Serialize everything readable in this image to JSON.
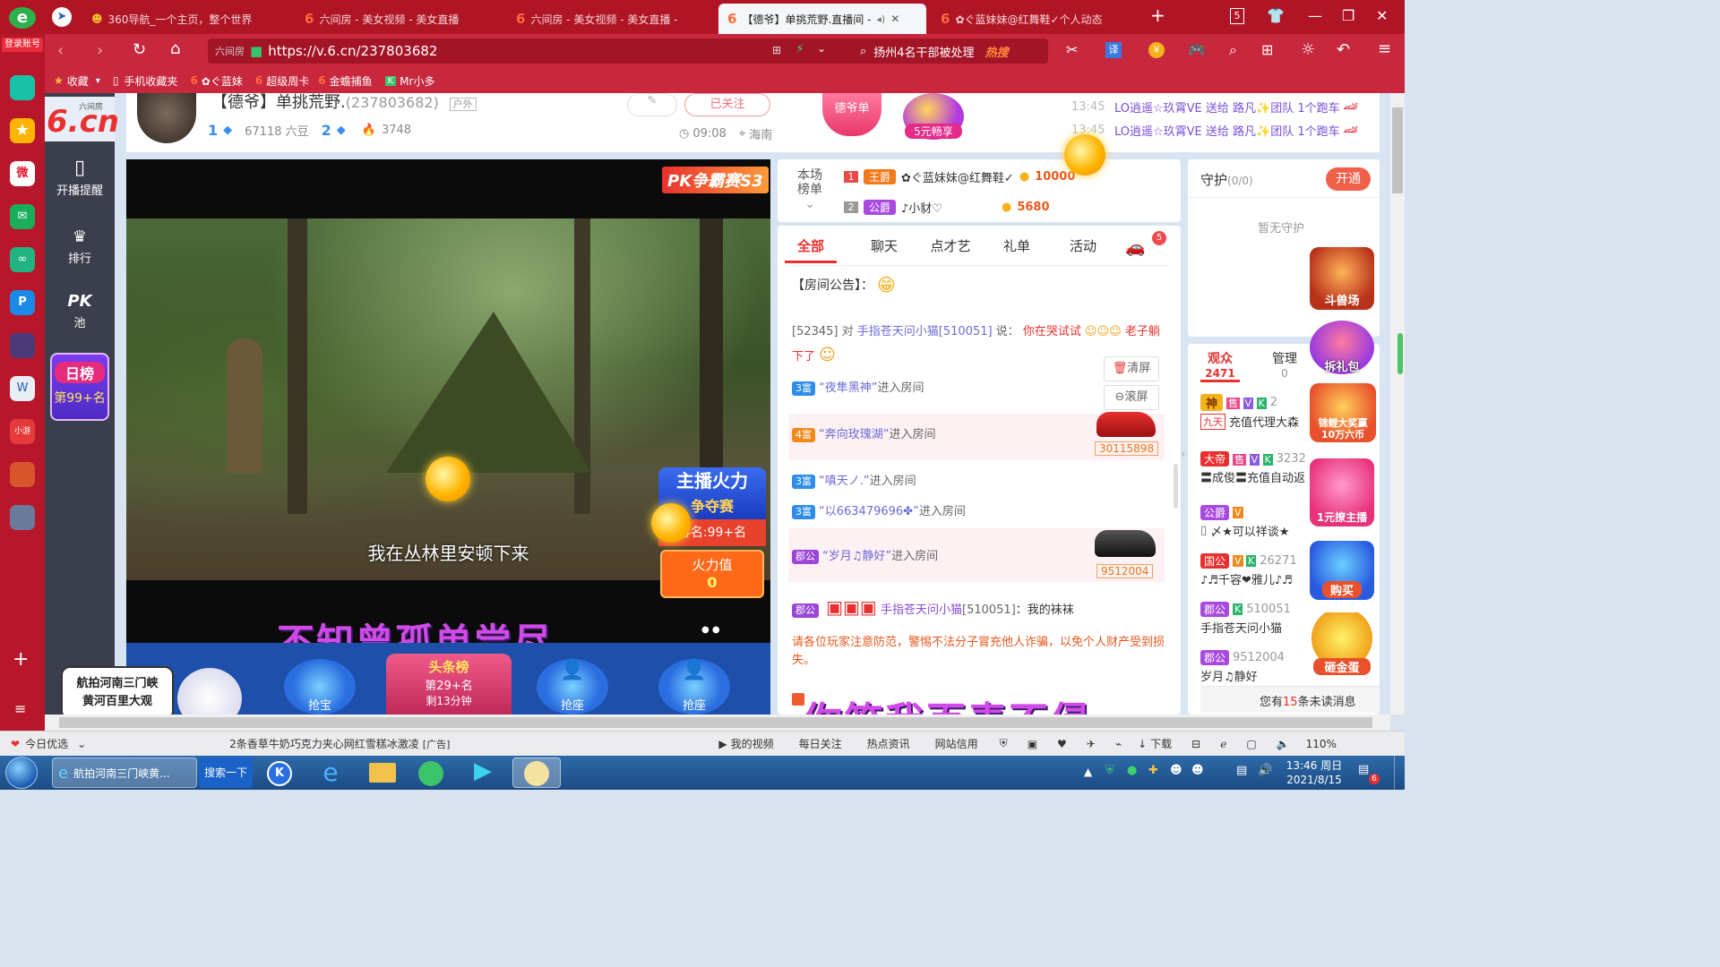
{
  "browser": {
    "tabs": [
      {
        "label": "360导航_一个主页，整个世界",
        "active": false
      },
      {
        "label": "六间房 - 美女视频 - 美女直播",
        "active": false
      },
      {
        "label": "六间房 - 美女视频 - 美女直播 -",
        "active": false
      },
      {
        "label": "【德爷】单挑荒野.直播间 -",
        "active": true
      },
      {
        "label": "✿ぐ蓝妹妹@红舞鞋✓个人动态",
        "active": false
      }
    ],
    "tab_count": "5",
    "url": "https://v.6.cn/237803682",
    "url_prefix": "六间房",
    "search_text": "扬州4名干部被处理",
    "search_hot": "热搜",
    "bookmarks": [
      "收藏",
      "手机收藏夹",
      "✿ぐ蓝妹",
      "超级周卡",
      "金蟾捕鱼",
      "Mr小多"
    ],
    "login_label": "登录账号",
    "zoom": "110%"
  },
  "site": {
    "logo_small": "六间房",
    "logo": "6.cn",
    "nav": [
      {
        "label": "开播提醒",
        "icon": "phone-icon"
      },
      {
        "label": "排行",
        "icon": "crown-icon"
      },
      {
        "label": "PK池",
        "icon": "pk-icon"
      }
    ],
    "rank_title": "日榜",
    "rank_value": "第99+名"
  },
  "room": {
    "title": "【德爷】单挑荒野.",
    "room_id": "(237803682)",
    "tag": "户外",
    "level1": "1",
    "fans_label": "67118 六豆",
    "level2": "2",
    "hot": "3748",
    "follow_label": "已关注",
    "time": "09:08",
    "location": "海南",
    "promo1": "德爷单",
    "promo2": "5元畅享",
    "gift_feed": [
      {
        "time": "13:45",
        "text": "LO逍遥☆玖霄VE 送给 路凡✨团队 1个跑车"
      },
      {
        "time": "13:45",
        "text": "LO逍遥☆玖霄VE 送给 路凡✨团队 1个跑车"
      }
    ]
  },
  "video": {
    "banner": "PK争霸赛S3",
    "subtitle": "我在丛林里安顿下来",
    "lyric1": "不知曾孤单尝尽",
    "lyric2": "你笑我百毒不侵",
    "fire_title1": "主播火力",
    "fire_title2": "争夺赛",
    "fire_rank": "排名:99+名",
    "fire_label": "火力值",
    "fire_value": "0",
    "seats": [
      "抢宝",
      "头条榜",
      "抢座",
      "抢座"
    ],
    "headline_rank": "第29+名",
    "headline_timer": "剩13分钟",
    "ad_text1": "航拍河南三门峡",
    "ad_text2": "黄河百里大观"
  },
  "board": {
    "label1": "本场",
    "label2": "榜单",
    "rows": [
      {
        "rank": "1",
        "title": "王爵",
        "name": "✿ぐ蓝妹妹@红舞鞋✓",
        "score": "10000"
      },
      {
        "rank": "2",
        "title": "公爵",
        "name": "♪小豺♡",
        "score": "5680"
      }
    ]
  },
  "chat": {
    "tabs": [
      "全部",
      "聊天",
      "点才艺",
      "礼单",
      "活动"
    ],
    "car_badge": "5",
    "notice_label": "【房间公告】：",
    "first_msg": {
      "id": "[52345]",
      "verb": "对",
      "target": "手指苍天问小猫[510051]",
      "said": "说：",
      "text": "你在哭试试",
      "tail": "老子躺下了"
    },
    "enter_msgs": [
      {
        "badge": "3富",
        "name": "“夜隼黑神”",
        "suffix": "进入房间"
      },
      {
        "badge": "4富",
        "name": "“奔向玫瑰湖”",
        "suffix": "进入房间"
      },
      {
        "badge": "3富",
        "name": "“嗔天ノ.”",
        "suffix": "进入房间"
      },
      {
        "badge": "3富",
        "name": "“以663479696✤”",
        "suffix": "进入房间"
      },
      {
        "badge": "郡公",
        "name": "“岁月♫静好”",
        "suffix": "进入房间"
      }
    ],
    "car1_id": "30115898",
    "car2_id": "9512004",
    "last_msg": {
      "badge": "郡公",
      "name": "手指苍天问小猫",
      "id": "[510051]",
      "text": "：我的袜袜"
    },
    "warning": "请各位玩家注意防范，警惕不法分子冒充他人诈骗，以免个人财产受到损失。",
    "clear_label": "清屏",
    "scroll_label": "滚屏"
  },
  "guard": {
    "title": "守护",
    "count": "(0/0)",
    "open_label": "开通",
    "empty": "暂无守护"
  },
  "audience": {
    "tab1_label": "观众",
    "tab1_count": "2471",
    "tab2_label": "管理",
    "tab2_count": "0",
    "rows": [
      {
        "badge": "神",
        "k": "2",
        "name": "九天",
        "sub": "充值代理大森"
      },
      {
        "badge": "大帝",
        "k": "3232",
        "name": "",
        "sub": "〓成俊〓充值自动返"
      },
      {
        "badge": "公爵",
        "k": "",
        "name": "",
        "sub": "〆★可以祥谈★"
      },
      {
        "badge": "国公",
        "k": "26271",
        "name": "",
        "sub": "♪♬千容❤雅儿♪♬"
      },
      {
        "badge": "郡公",
        "k": "510051",
        "name": "",
        "sub": "手指苍天问小猫"
      },
      {
        "badge": "郡公",
        "k": "9512004",
        "name": "",
        "sub": "岁月♫静好"
      }
    ],
    "unread": "您有15条未读消息",
    "unread_prefix": "您有",
    "unread_num": "15",
    "unread_suffix": "条未读消息"
  },
  "promos_right": [
    "斗兽场",
    "拆礼包",
    "锦鲤大奖赢10万六币",
    "1元撩主播",
    "购买",
    "砸金蛋"
  ],
  "statusbar": {
    "left": "今日优选",
    "news": "2条香草牛奶巧克力夹心网红雪糕冰激凌",
    "items": [
      "我的视频",
      "每日关注",
      "热点资讯",
      "网站信用",
      "下载"
    ],
    "zoom": "110%"
  },
  "taskbar": {
    "app1": "航拍河南三门峡黄...",
    "search_btn": "搜索一下",
    "time": "13:46 周日",
    "date": "2021/8/15",
    "notify": "6"
  }
}
